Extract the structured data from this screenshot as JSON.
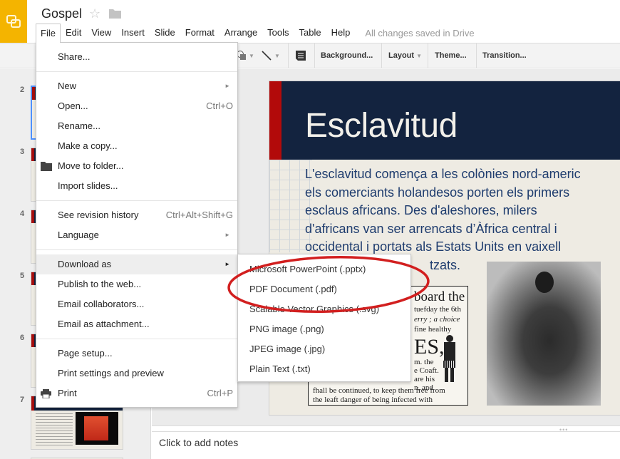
{
  "app": {
    "doc_title": "Gospel",
    "brand_color": "#f4b400",
    "save_status": "All changes saved in Drive"
  },
  "menubar": [
    "File",
    "Edit",
    "View",
    "Insert",
    "Slide",
    "Format",
    "Arrange",
    "Tools",
    "Table",
    "Help"
  ],
  "toolbar": {
    "background_label": "Background...",
    "layout_label": "Layout",
    "theme_label": "Theme...",
    "transition_label": "Transition..."
  },
  "filmstrip": {
    "slide_numbers": [
      "2",
      "3",
      "4",
      "5",
      "6",
      "7"
    ],
    "selected": "2"
  },
  "file_menu": {
    "share": "Share...",
    "new": "New",
    "open": "Open...",
    "open_shortcut": "Ctrl+O",
    "rename": "Rename...",
    "make_copy": "Make a copy...",
    "move_to_folder": "Move to folder...",
    "import_slides": "Import slides...",
    "revision_history": "See revision history",
    "revision_history_shortcut": "Ctrl+Alt+Shift+G",
    "language": "Language",
    "download_as": "Download as",
    "publish": "Publish to the web...",
    "email_collaborators": "Email collaborators...",
    "email_attachment": "Email as attachment...",
    "page_setup": "Page setup...",
    "print_settings": "Print settings and preview",
    "print": "Print",
    "print_shortcut": "Ctrl+P"
  },
  "download_submenu": [
    "Microsoft PowerPoint (.pptx)",
    "PDF Document (.pdf)",
    "Scalable Vector Graphics (.svg)",
    "PNG image (.png)",
    "JPEG image (.jpg)",
    "Plain Text (.txt)"
  ],
  "slide": {
    "title": "Esclavitud",
    "body_lines": [
      "L'esclavitud comença a les colònies nord-americ",
      "els comerciants holandesos porten els primers",
      "esclaus africans. Des d'aleshores, milers",
      "d'africans van ser arrencats d’Àfrica central i",
      "occidental i portats als Estats Units en vaixell",
      "                                   tzats."
    ],
    "ad_text": {
      "l1": "board the",
      "l2": "tuefday the 6th",
      "l3": "erry ; a choice",
      "l4": "fine healthy",
      "l5": "ES,",
      "l6": "m. the",
      "l7": "e Coaft.",
      "l8": "are his",
      "l9": "n, and",
      "l10": "fhall be continued, to keep them free from",
      "l11": "the leaft danger of being infected with"
    }
  },
  "notes": {
    "placeholder": "Click to add notes"
  }
}
